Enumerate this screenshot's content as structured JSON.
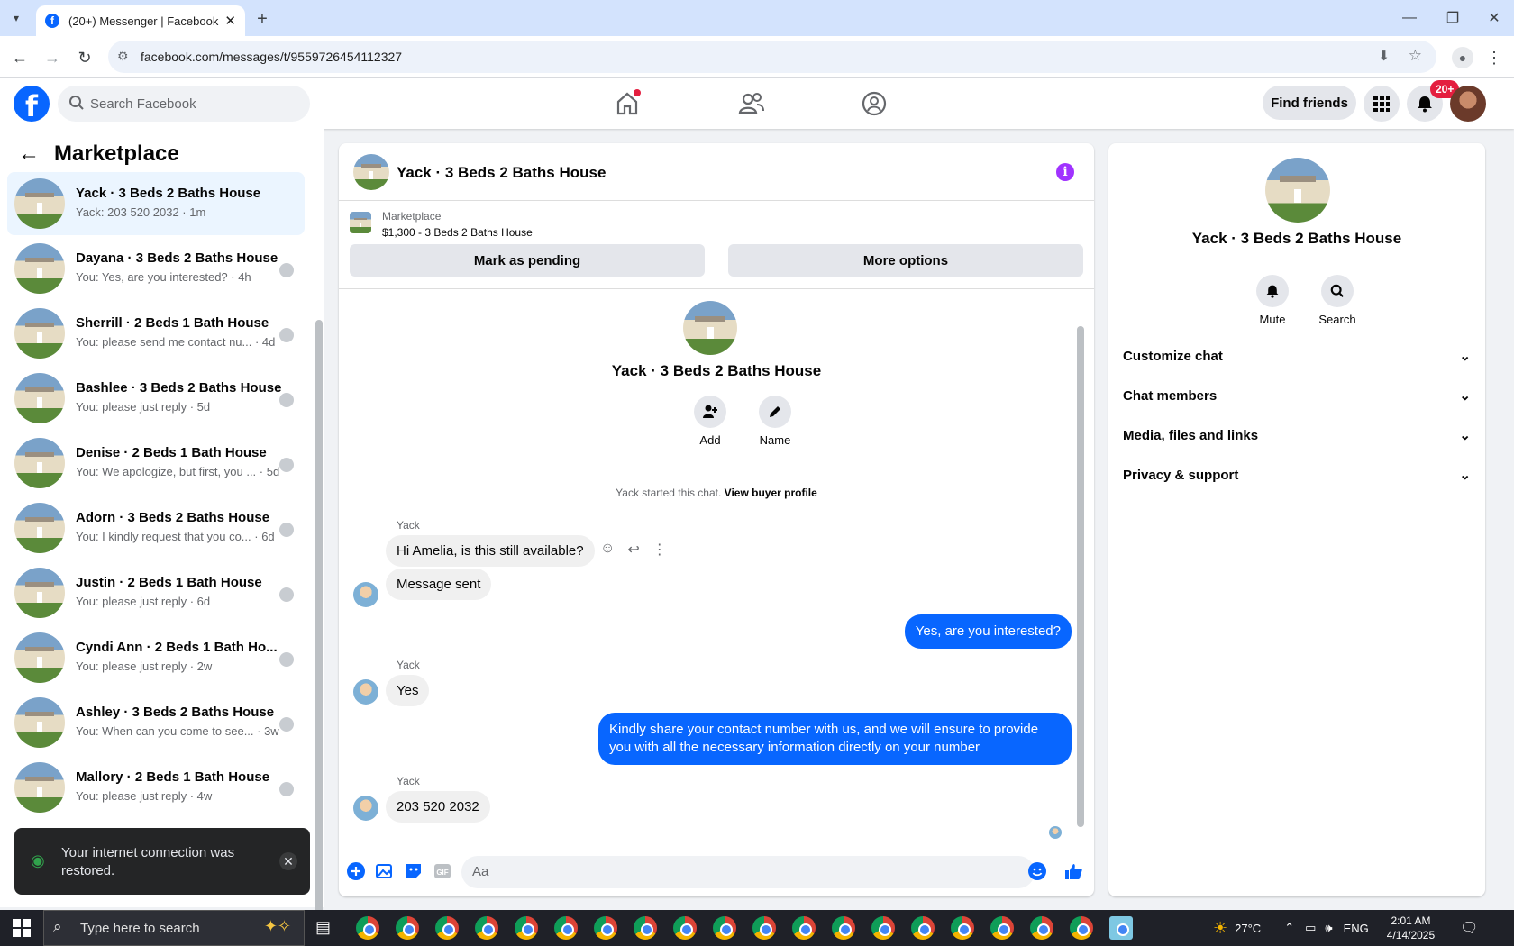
{
  "browser": {
    "tab_title": "(20+) Messenger | Facebook",
    "url": "facebook.com/messages/t/9559726454112327"
  },
  "fb": {
    "search_placeholder": "Search Facebook",
    "find_friends": "Find friends",
    "notif_badge": "20+"
  },
  "sidebar": {
    "title": "Marketplace",
    "conversations": [
      {
        "title": "Yack · 3 Beds 2 Baths House",
        "snippet": "Yack: 203 520 2032 · 1m",
        "active": true
      },
      {
        "title": "Dayana · 3 Beds 2 Baths House",
        "snippet": "You: Yes, are you interested? · 4h"
      },
      {
        "title": "Sherrill · 2 Beds 1 Bath House",
        "snippet": "You: please send me contact nu... · 4d"
      },
      {
        "title": "Bashlee · 3 Beds 2 Baths House",
        "snippet": "You: please just reply · 5d"
      },
      {
        "title": "Denise · 2 Beds 1 Bath House",
        "snippet": "You: We apologize, but first, you ... · 5d"
      },
      {
        "title": "Adorn · 3 Beds 2 Baths House",
        "snippet": "You: I kindly request that you co... · 6d"
      },
      {
        "title": "Justin · 2 Beds 1 Bath House",
        "snippet": "You: please just reply · 6d"
      },
      {
        "title": "Cyndi Ann · 2 Beds 1 Bath Ho...",
        "snippet": "You: please just reply · 2w"
      },
      {
        "title": "Ashley · 3 Beds 2 Baths House",
        "snippet": "You: When can you come to see... · 3w"
      },
      {
        "title": "Mallory · 2 Beds 1 Bath House",
        "snippet": "You: please just reply · 4w"
      }
    ]
  },
  "toast": {
    "text": "Your internet connection was restored."
  },
  "chat": {
    "title": "Yack · 3 Beds 2 Baths House",
    "listing_label": "Marketplace",
    "listing_price": "$1,300 - 3 Beds 2 Baths House",
    "btn_pending": "Mark as pending",
    "btn_more": "More options",
    "profile_name": "Yack · 3 Beds 2 Baths House",
    "add_label": "Add",
    "name_label": "Name",
    "started_text": "Yack started this chat.",
    "view_buyer": "View buyer profile",
    "sender": "Yack",
    "msg1": "Hi Amelia, is this still available?",
    "msg2": "Message sent",
    "msg3": "Yes, are you interested?",
    "msg4": "Yes",
    "msg5": "Kindly share your contact number with us, and we will ensure to provide you with all the necessary information directly on your number",
    "msg6": "203 520 2032",
    "compose_placeholder": "Aa"
  },
  "details": {
    "name": "Yack · 3 Beds 2 Baths House",
    "mute": "Mute",
    "search": "Search",
    "sections": [
      "Customize chat",
      "Chat members",
      "Media, files and links",
      "Privacy & support"
    ]
  },
  "taskbar": {
    "search_placeholder": "Type here to search",
    "temp": "27°C",
    "lang": "ENG",
    "time": "2:01 AM",
    "date": "4/14/2025"
  }
}
